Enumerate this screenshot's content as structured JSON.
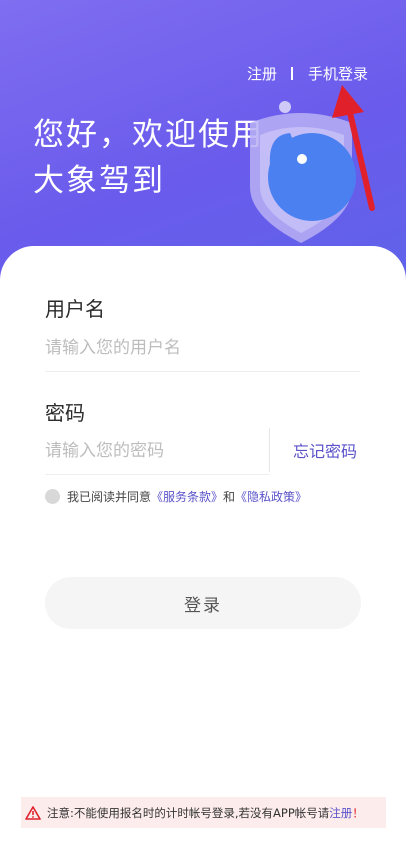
{
  "header": {
    "register_label": "注册",
    "phone_login_label": "手机登录",
    "welcome_line1": "您好，欢迎使用",
    "welcome_line2": "大象驾到"
  },
  "form": {
    "username_label": "用户名",
    "username_placeholder": "请输入您的用户名",
    "password_label": "密码",
    "password_placeholder": "请输入您的密码",
    "forgot_password_label": "忘记密码"
  },
  "agreement": {
    "prefix": "我已阅读并同意",
    "terms_link": "《服务条款》",
    "and": "和",
    "privacy_link": "《隐私政策》"
  },
  "login_button_label": "登录",
  "notice": {
    "text": "注意:不能使用报名时的计时帐号登录,若没有APP帐号请",
    "register_link": "注册",
    "suffix": "！"
  },
  "colors": {
    "hero": "#6a5bec",
    "accent": "#5a52c9",
    "arrow": "#e0202a"
  },
  "icons": {
    "mascot": "elephant-shield-icon",
    "warning": "warning-triangle-icon"
  }
}
